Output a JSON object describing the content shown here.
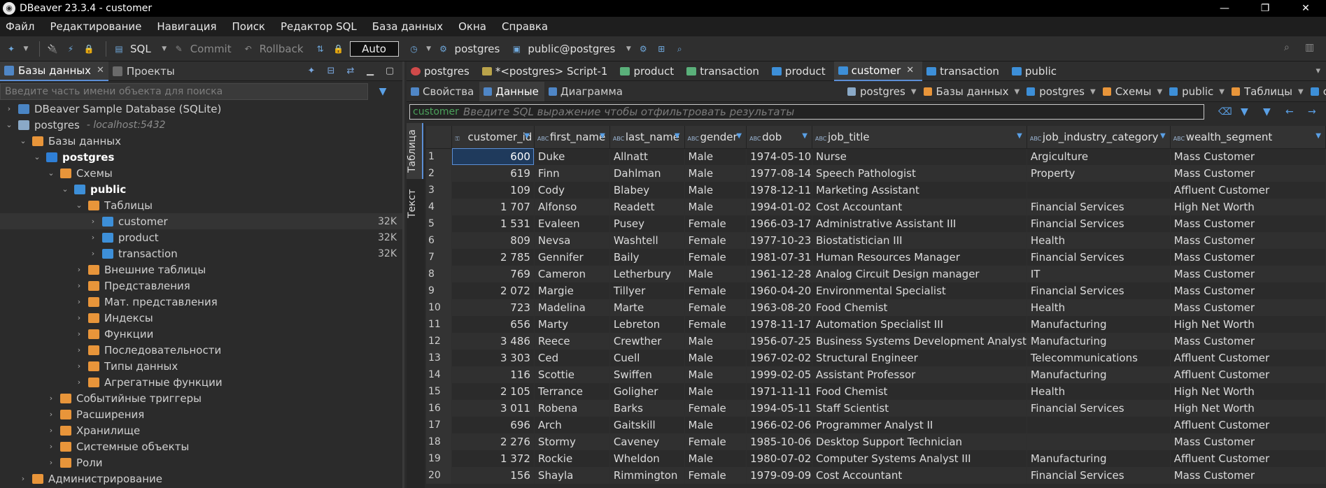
{
  "window": {
    "title": "DBeaver 23.3.4 - customer",
    "controls": [
      "—",
      "❐",
      "✕"
    ]
  },
  "menu": [
    "Файл",
    "Редактирование",
    "Навигация",
    "Поиск",
    "Редактор SQL",
    "База данных",
    "Окна",
    "Справка"
  ],
  "toolbar": {
    "sql_label": "SQL",
    "commit_label": "Commit",
    "rollback_label": "Rollback",
    "auto_label": "Auto",
    "connection_label": "postgres",
    "schema_label": "public@postgres"
  },
  "left_panel": {
    "tab_db": "Базы данных",
    "tab_projects": "Проекты",
    "search_placeholder": "Введите часть имени объекта для поиска",
    "tree": [
      {
        "label": "DBeaver Sample Database (SQLite)",
        "level": 0,
        "icon": "sqlite-icon",
        "chev": "›"
      },
      {
        "label": "postgres",
        "sub": "- localhost:5432",
        "level": 0,
        "icon": "postgres-icon",
        "chev": "⌄"
      },
      {
        "label": "Базы данных",
        "level": 1,
        "icon": "folder-icon",
        "chev": "⌄"
      },
      {
        "label": "postgres",
        "level": 2,
        "icon": "database-icon",
        "chev": "⌄",
        "bold": true
      },
      {
        "label": "Схемы",
        "level": 3,
        "icon": "folder-icon",
        "chev": "⌄"
      },
      {
        "label": "public",
        "level": 4,
        "icon": "schema-icon",
        "chev": "⌄",
        "bold": true
      },
      {
        "label": "Таблицы",
        "level": 5,
        "icon": "folder-icon",
        "chev": "⌄"
      },
      {
        "label": "customer",
        "level": 6,
        "icon": "table-icon",
        "chev": "›",
        "size": "32K",
        "selected": true
      },
      {
        "label": "product",
        "level": 6,
        "icon": "table-icon",
        "chev": "›",
        "size": "32K"
      },
      {
        "label": "transaction",
        "level": 6,
        "icon": "table-icon",
        "chev": "›",
        "size": "32K"
      },
      {
        "label": "Внешние таблицы",
        "level": 5,
        "icon": "folder-icon",
        "chev": "›"
      },
      {
        "label": "Представления",
        "level": 5,
        "icon": "folder-icon",
        "chev": "›"
      },
      {
        "label": "Мат. представления",
        "level": 5,
        "icon": "folder-icon",
        "chev": "›"
      },
      {
        "label": "Индексы",
        "level": 5,
        "icon": "folder-icon",
        "chev": "›"
      },
      {
        "label": "Функции",
        "level": 5,
        "icon": "folder-icon",
        "chev": "›"
      },
      {
        "label": "Последовательности",
        "level": 5,
        "icon": "folder-icon",
        "chev": "›"
      },
      {
        "label": "Типы данных",
        "level": 5,
        "icon": "folder-icon",
        "chev": "›"
      },
      {
        "label": "Агрегатные функции",
        "level": 5,
        "icon": "folder-icon",
        "chev": "›"
      },
      {
        "label": "Событийные триггеры",
        "level": 3,
        "icon": "folder-icon",
        "chev": "›"
      },
      {
        "label": "Расширения",
        "level": 3,
        "icon": "folder-icon",
        "chev": "›"
      },
      {
        "label": "Хранилище",
        "level": 3,
        "icon": "folder-icon",
        "chev": "›"
      },
      {
        "label": "Системные объекты",
        "level": 3,
        "icon": "folder-icon",
        "chev": "›"
      },
      {
        "label": "Роли",
        "level": 3,
        "icon": "folder-icon",
        "chev": "›"
      },
      {
        "label": "Администрирование",
        "level": 1,
        "icon": "folder-icon",
        "chev": "›"
      }
    ]
  },
  "editor_tabs": [
    {
      "label": "postgres",
      "icon": "red",
      "active": false
    },
    {
      "label": "*<postgres> Script-1",
      "icon": "script",
      "active": false
    },
    {
      "label": "product",
      "icon": "view",
      "active": false
    },
    {
      "label": "transaction",
      "icon": "view",
      "active": false
    },
    {
      "label": "product",
      "icon": "table",
      "active": false
    },
    {
      "label": "customer",
      "icon": "table",
      "active": true
    },
    {
      "label": "transaction",
      "icon": "table",
      "active": false
    },
    {
      "label": "public",
      "icon": "schema",
      "active": false
    }
  ],
  "sub_tabs": [
    {
      "label": "Свойства",
      "active": false
    },
    {
      "label": "Данные",
      "active": true
    },
    {
      "label": "Диаграмма",
      "active": false
    }
  ],
  "breadcrumbs": [
    "postgres",
    "Базы данных",
    "postgres",
    "Схемы",
    "public",
    "Таблицы",
    "custom"
  ],
  "filter": {
    "object": "customer",
    "placeholder": "Введите SQL выражение чтобы отфильтровать результаты"
  },
  "vtabs": {
    "table": "Таблица",
    "text": "Текст"
  },
  "grid": {
    "columns": [
      "customer_id",
      "first_name",
      "last_name",
      "gender",
      "dob",
      "job_title",
      "job_industry_category",
      "wealth_segment"
    ],
    "rows": [
      [
        "1",
        "600",
        "Duke",
        "Allnatt",
        "Male",
        "1974-05-10",
        "Nurse",
        "Argiculture",
        "Mass Customer"
      ],
      [
        "2",
        "619",
        "Finn",
        "Dahlman",
        "Male",
        "1977-08-14",
        "Speech Pathologist",
        "Property",
        "Mass Customer"
      ],
      [
        "3",
        "109",
        "Cody",
        "Blabey",
        "Male",
        "1978-12-11",
        "Marketing Assistant",
        "",
        "Affluent Customer"
      ],
      [
        "4",
        "1 707",
        "Alfonso",
        "Readett",
        "Male",
        "1994-01-02",
        "Cost Accountant",
        "Financial Services",
        "High Net Worth"
      ],
      [
        "5",
        "1 531",
        "Evaleen",
        "Pusey",
        "Female",
        "1966-03-17",
        "Administrative Assistant III",
        "Financial Services",
        "Mass Customer"
      ],
      [
        "6",
        "809",
        "Nevsa",
        "Washtell",
        "Female",
        "1977-10-23",
        "Biostatistician III",
        "Health",
        "Mass Customer"
      ],
      [
        "7",
        "2 785",
        "Gennifer",
        "Baily",
        "Female",
        "1981-07-31",
        "Human Resources Manager",
        "Financial Services",
        "Mass Customer"
      ],
      [
        "8",
        "769",
        "Cameron",
        "Letherbury",
        "Male",
        "1961-12-28",
        "Analog Circuit Design manager",
        "IT",
        "Mass Customer"
      ],
      [
        "9",
        "2 072",
        "Margie",
        "Tillyer",
        "Female",
        "1960-04-20",
        "Environmental Specialist",
        "Financial Services",
        "Mass Customer"
      ],
      [
        "10",
        "723",
        "Madelina",
        "Marte",
        "Female",
        "1963-08-20",
        "Food Chemist",
        "Health",
        "Mass Customer"
      ],
      [
        "11",
        "656",
        "Marty",
        "Lebreton",
        "Female",
        "1978-11-17",
        "Automation Specialist III",
        "Manufacturing",
        "High Net Worth"
      ],
      [
        "12",
        "3 486",
        "Reece",
        "Crewther",
        "Male",
        "1956-07-25",
        "Business Systems Development Analyst",
        "Manufacturing",
        "Mass Customer"
      ],
      [
        "13",
        "3 303",
        "Ced",
        "Cuell",
        "Male",
        "1967-02-02",
        "Structural Engineer",
        "Telecommunications",
        "Affluent Customer"
      ],
      [
        "14",
        "116",
        "Scottie",
        "Swiffen",
        "Male",
        "1999-02-05",
        "Assistant Professor",
        "Manufacturing",
        "Affluent Customer"
      ],
      [
        "15",
        "2 105",
        "Terrance",
        "Goligher",
        "Male",
        "1971-11-11",
        "Food Chemist",
        "Health",
        "High Net Worth"
      ],
      [
        "16",
        "3 011",
        "Robena",
        "Barks",
        "Female",
        "1994-05-11",
        "Staff Scientist",
        "Financial Services",
        "High Net Worth"
      ],
      [
        "17",
        "696",
        "Arch",
        "Gaitskill",
        "Male",
        "1966-02-06",
        "Programmer Analyst II",
        "",
        "Affluent Customer"
      ],
      [
        "18",
        "2 276",
        "Stormy",
        "Caveney",
        "Female",
        "1985-10-06",
        "Desktop Support Technician",
        "",
        "Mass Customer"
      ],
      [
        "19",
        "1 372",
        "Rockie",
        "Wheldon",
        "Male",
        "1980-07-02",
        "Computer Systems Analyst III",
        "Manufacturing",
        "Affluent Customer"
      ],
      [
        "20",
        "156",
        "Shayla",
        "Rimmington",
        "Female",
        "1979-09-09",
        "Cost Accountant",
        "Financial Services",
        "Mass Customer"
      ]
    ]
  }
}
